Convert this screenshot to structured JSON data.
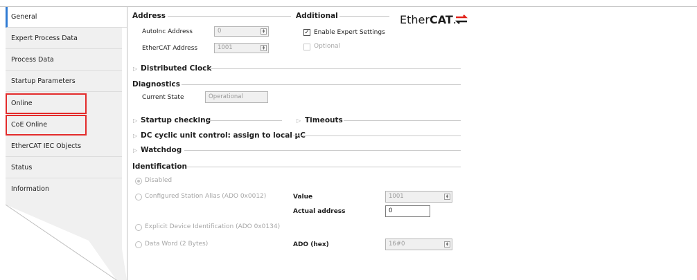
{
  "sidebar": {
    "tabs": [
      {
        "label": "General"
      },
      {
        "label": "Expert Process Data"
      },
      {
        "label": "Process Data"
      },
      {
        "label": "Startup Parameters"
      },
      {
        "label": "Online"
      },
      {
        "label": "CoE Online"
      },
      {
        "label": "EtherCAT IEC Objects"
      },
      {
        "label": "Status"
      },
      {
        "label": "Information"
      }
    ]
  },
  "address": {
    "title": "Address",
    "autoinc_label": "AutoInc Address",
    "autoinc_value": "0",
    "ethercat_label": "EtherCAT Address",
    "ethercat_value": "1001"
  },
  "additional": {
    "title": "Additional",
    "enable_expert": "Enable Expert Settings",
    "optional": "Optional"
  },
  "logo": {
    "text_light": "Ether",
    "text_bold": "CAT",
    "mark": ".",
    "color": "#e2231a"
  },
  "sections": {
    "distributed_clock": "Distributed Clock",
    "diagnostics": "Diagnostics",
    "current_state_label": "Current State",
    "current_state_value": "Operational",
    "startup_checking": "Startup checking",
    "timeouts": "Timeouts",
    "dc_cyclic": "DC cyclic unit control: assign to local µC",
    "watchdog": "Watchdog"
  },
  "identification": {
    "title": "Identification",
    "disabled": "Disabled",
    "configured_alias": "Configured Station Alias (ADO 0x0012)",
    "explicit_device": "Explicit Device Identification (ADO 0x0134)",
    "data_word": "Data Word (2 Bytes)",
    "value_label": "Value",
    "value_value": "1001",
    "actual_label": "Actual address",
    "actual_value": "0",
    "ado_label": "ADO (hex)",
    "ado_value": "16#0"
  }
}
